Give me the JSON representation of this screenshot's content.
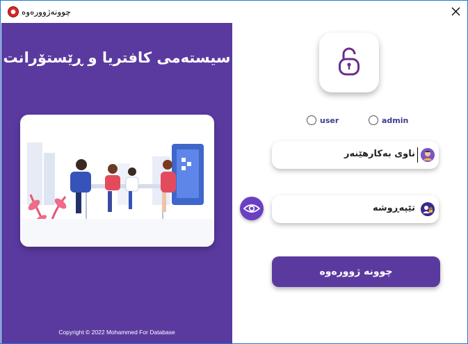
{
  "window": {
    "title": "چوونەژوورەوە",
    "app_icon": "app-icon",
    "close_icon": "close-icon"
  },
  "left_panel": {
    "title": "سیستەمی کافتریا و ڕێستۆرانت",
    "illustration": "cafeteria-people-illustration",
    "copyright": "Copyright © 2022  Mohammed For Database",
    "background_color": "#5b3aa0"
  },
  "login": {
    "lock_icon": "unlocked-padlock-icon",
    "roles": [
      {
        "label": "user",
        "selected": false
      },
      {
        "label": "admin",
        "selected": false
      }
    ],
    "username": {
      "placeholder": "ناوی بەکارهێنەر",
      "icon": "user-avatar-icon"
    },
    "password": {
      "placeholder": "تێپەڕوشە",
      "icon": "user-lock-icon"
    },
    "show_password_icon": "eye-icon",
    "submit_label": "چوونە ژوورەوە",
    "accent_color": "#5b3aa0"
  }
}
